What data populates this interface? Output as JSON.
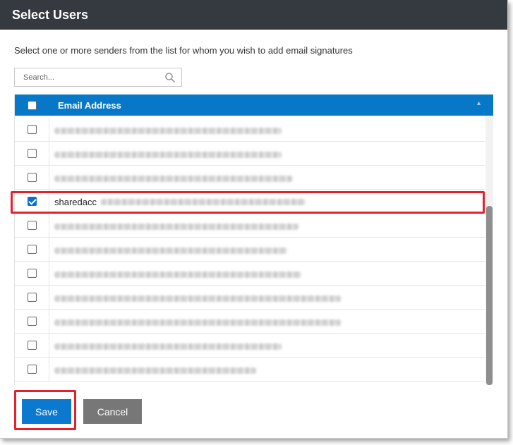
{
  "dialog": {
    "title": "Select Users",
    "instruction": "Select one or more senders from the list for whom you wish to add email signatures"
  },
  "search": {
    "placeholder": "Search..."
  },
  "table": {
    "header": {
      "column_label": "Email Address",
      "select_all_checked": false
    },
    "rows": [
      {
        "checked": false,
        "email_visible": "",
        "redacted": true
      },
      {
        "checked": false,
        "email_visible": "",
        "redacted": true
      },
      {
        "checked": false,
        "email_visible": "",
        "redacted": true
      },
      {
        "checked": true,
        "email_visible": "sharedacc",
        "redacted": true
      },
      {
        "checked": false,
        "email_visible": "",
        "redacted": true
      },
      {
        "checked": false,
        "email_visible": "",
        "redacted": true
      },
      {
        "checked": false,
        "email_visible": "",
        "redacted": true
      },
      {
        "checked": false,
        "email_visible": "",
        "redacted": true
      },
      {
        "checked": false,
        "email_visible": "",
        "redacted": true
      },
      {
        "checked": false,
        "email_visible": "",
        "redacted": true
      },
      {
        "checked": false,
        "email_visible": "",
        "redacted": true
      }
    ]
  },
  "buttons": {
    "save_label": "Save",
    "cancel_label": "Cancel"
  },
  "colors": {
    "titlebar": "#343a40",
    "header": "#0778c7",
    "save": "#0b79d0",
    "cancel": "#777777",
    "annotation": "#e3212d"
  }
}
